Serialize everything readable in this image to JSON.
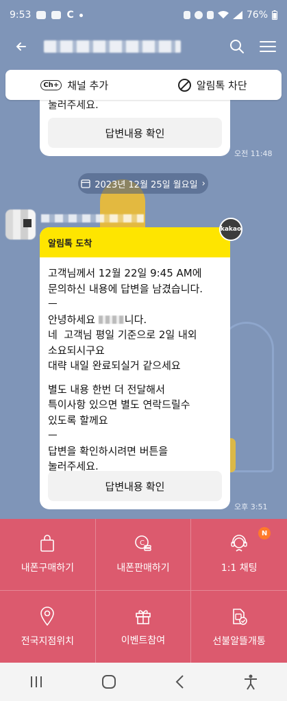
{
  "status_bar": {
    "time": "9:53",
    "carrier_icon": "C",
    "battery": "76%"
  },
  "header": {
    "back_icon": "back-arrow-icon",
    "search_icon": "search-icon",
    "menu_icon": "menu-icon"
  },
  "channel_bar": {
    "add_channel": "채널 추가",
    "ch_icon_text": "Ch+",
    "block": "알림톡 차단"
  },
  "prev_message": {
    "cut_text": "눌러주세요.",
    "button": "답변내용 확인",
    "time": "오전 11:48"
  },
  "date_divider": "2023년 12월 25일 월요일",
  "message": {
    "badge": "kakao",
    "header": "알림톡 도착",
    "lines": {
      "l1": "고객님께서 12월 22일 9:45 AM에",
      "l2": "문의하신 내용에 답변을 남겼습니다.",
      "l3": "ㅡ",
      "l4a": "안녕하세요 ",
      "l4b": "니다.",
      "l5": "네  고객님 평일 기준으로 2일 내외",
      "l6": "소요되시구요",
      "l7": "대략 내일 완료되실거 같으세요",
      "l8": "별도 내용 한번 더 전달해서",
      "l9": "특이사항 있으면 별도 연락드릴수",
      "l10": "있도록 할께요",
      "l11": "ㅡ",
      "l12": "답변을 확인하시려면 버튼을",
      "l13": "눌러주세요."
    },
    "button": "답변내용 확인",
    "time": "오후 3:51"
  },
  "menu": [
    {
      "label": "내폰구매하기",
      "icon": "shopping-bag-icon"
    },
    {
      "label": "내폰판매하기",
      "icon": "coin-stack-icon"
    },
    {
      "label": "1:1 채팅",
      "icon": "headset-agent-icon",
      "badge": "N"
    },
    {
      "label": "전국지점위치",
      "icon": "map-pin-icon"
    },
    {
      "label": "이벤트참여",
      "icon": "gift-icon"
    },
    {
      "label": "선불알뜰개통",
      "icon": "sim-check-icon"
    }
  ],
  "colors": {
    "background": "#7f95b8",
    "menu": "#dc5a6e",
    "alimtalk_header": "#fee500"
  }
}
